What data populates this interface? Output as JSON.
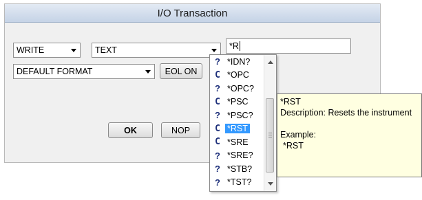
{
  "dialog": {
    "title": "I/O Transaction",
    "direction": "WRITE",
    "data_type": "TEXT",
    "format": "DEFAULT FORMAT",
    "command_value": "*R",
    "buttons": {
      "eol": "EOL ON",
      "ok": "OK",
      "nop": "NOP"
    }
  },
  "autocomplete": {
    "items": [
      {
        "icon": "query-icon",
        "glyph": "?",
        "label": "*IDN?"
      },
      {
        "icon": "command-icon",
        "glyph": "C",
        "label": "*OPC"
      },
      {
        "icon": "query-icon",
        "glyph": "?",
        "label": "*OPC?"
      },
      {
        "icon": "command-icon",
        "glyph": "C",
        "label": "*PSC"
      },
      {
        "icon": "query-icon",
        "glyph": "?",
        "label": "*PSC?"
      },
      {
        "icon": "command-icon",
        "glyph": "C",
        "label": "*RST",
        "selected": true
      },
      {
        "icon": "command-icon",
        "glyph": "C",
        "label": "*SRE"
      },
      {
        "icon": "query-icon",
        "glyph": "?",
        "label": "*SRE?"
      },
      {
        "icon": "query-icon",
        "glyph": "?",
        "label": "*STB?"
      },
      {
        "icon": "query-icon",
        "glyph": "?",
        "label": "*TST?"
      }
    ],
    "selected_index": 5
  },
  "tooltip": {
    "name": "*RST",
    "description": "Description: Resets the instrument",
    "example_label": "Example:",
    "example_value": "*RST"
  },
  "colors": {
    "title_gradient_top": "#e3eaf4",
    "title_gradient_bottom": "#c5d3e6",
    "selection": "#3399ff",
    "tooltip_bg": "#ffffe1",
    "icon_color": "#1d2f7a"
  }
}
